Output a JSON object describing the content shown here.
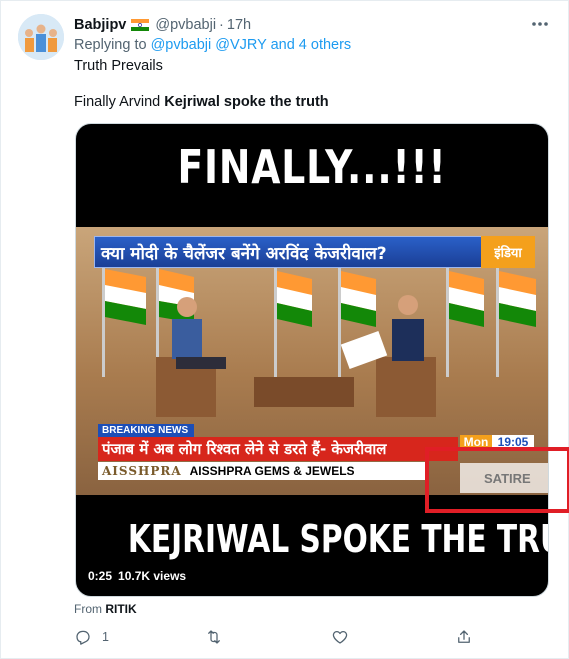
{
  "user": {
    "display_name": "Babjipv",
    "handle": "@pvbabji",
    "separator": "·",
    "time": "17h"
  },
  "reply": {
    "prefix": "Replying to",
    "mentions": "@pvbabji @VJRY and 4 others"
  },
  "tweet": {
    "line1": "Truth Prevails",
    "line2_prefix": "Finally Arvind ",
    "line2_bold": "Kejriwal spoke the truth"
  },
  "media": {
    "top_caption": "FINALLY...!!!",
    "headline": "क्या मोदी के चैलेंजर बनेंगे अरविंद केजरीवाल?",
    "channel_logo": "इंडिया",
    "breaking_label": "BREAKING NEWS",
    "ticker": "पंजाब में अब लोग रिश्वत लेने से डरते हैं- केजरीवाल",
    "clock_day": "Mon",
    "clock_time": "19:05",
    "sponsor_logo": "AISSHPRA",
    "sponsor_name": "AISSHPRA GEMS & JEWELS",
    "satire_label": "SATIRE",
    "bottom_caption": "KEJRIWAL SPOKE THE TRUTH",
    "duration": "0:25",
    "views": "10.7K views"
  },
  "source": {
    "prefix": "From",
    "name": "RITIK"
  },
  "actions": {
    "reply_count": "1",
    "retweet_count": "",
    "like_count": "",
    "share_count": ""
  },
  "icons": [
    "flag-india-icon",
    "more-icon",
    "reply-icon",
    "retweet-icon",
    "like-icon",
    "share-icon"
  ],
  "colors": {
    "link": "#1d9bf0",
    "secondary_text": "#536471",
    "highlight_box": "#e01e26"
  }
}
